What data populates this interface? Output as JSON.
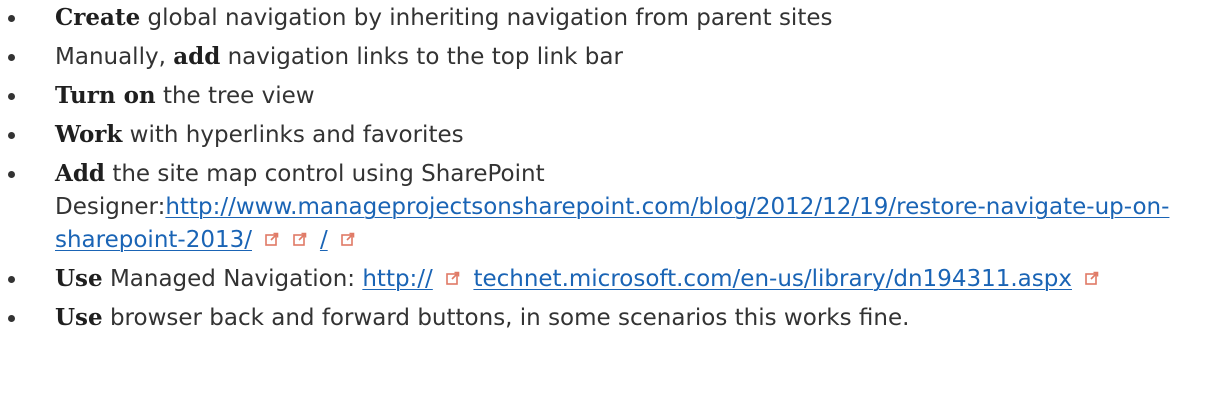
{
  "colors": {
    "text": "#333333",
    "keyword": "#1f1f1f",
    "link": "#1a64b5",
    "icon": "#e07a66"
  },
  "items": [
    {
      "keyword": "Create",
      "text": " global navigation by inheriting navigation from parent sites"
    },
    {
      "prefix": "Manually, ",
      "keyword": "add",
      "text": " navigation links to the top link bar"
    },
    {
      "keyword": "Turn on",
      "text": " the tree view"
    },
    {
      "keyword": "Work",
      "text": " with hyperlinks and favorites"
    },
    {
      "keyword": "Add",
      "text": " the site map control using SharePoint Designer:",
      "link1": "http://www.manageprojectsonsharepoint.com/blog/2012/12/19/restore-navigate-up-on-sharepoint-2013/",
      "link2": "/"
    },
    {
      "keyword": "Use",
      "text": " Managed Navigation: ",
      "link1": "http://",
      "link2": "technet.microsoft.com/en-us/library/dn194311.aspx"
    },
    {
      "keyword": "Use",
      "text": " browser back and forward buttons, in some scenarios this works fine."
    }
  ],
  "icons": {
    "external": "external-link-icon"
  }
}
